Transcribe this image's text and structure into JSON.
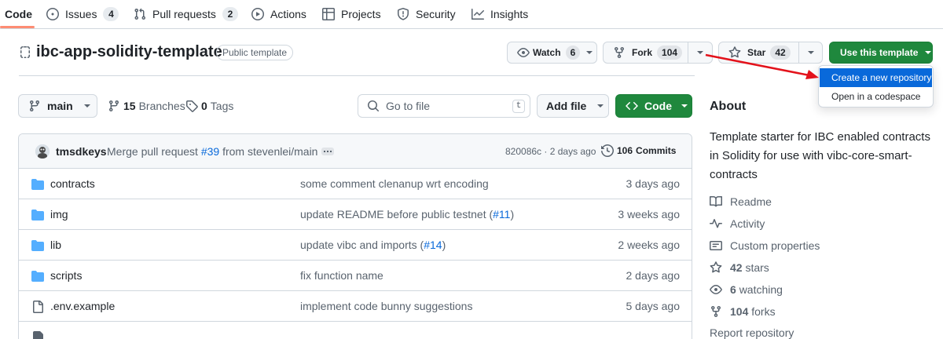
{
  "nav": {
    "tabs": [
      {
        "label": "Code",
        "icon": "code-icon"
      },
      {
        "label": "Issues",
        "count": "4",
        "icon": "issue-icon"
      },
      {
        "label": "Pull requests",
        "count": "2",
        "icon": "pull-request-icon"
      },
      {
        "label": "Actions",
        "icon": "play-icon"
      },
      {
        "label": "Projects",
        "icon": "table-icon"
      },
      {
        "label": "Security",
        "icon": "shield-icon"
      },
      {
        "label": "Insights",
        "icon": "graph-icon"
      }
    ]
  },
  "repo": {
    "name": "ibc-app-solidity-template",
    "visibility": "Public template",
    "watch_label": "Watch",
    "watch_count": "6",
    "fork_label": "Fork",
    "fork_count": "104",
    "star_label": "Star",
    "star_count": "42",
    "template_label": "Use this template"
  },
  "template_menu": {
    "items": [
      "Create a new repository",
      "Open in a codespace"
    ]
  },
  "toolbar": {
    "branch": "main",
    "branches_count": "15",
    "branches_label": "Branches",
    "tags_count": "0",
    "tags_label": "Tags",
    "search_placeholder": "Go to file",
    "search_key": "t",
    "add_file_label": "Add file",
    "code_label": "Code"
  },
  "commit": {
    "author": "tmsdkeys",
    "message_prefix": "Merge pull request",
    "pr_link": "#39",
    "message_suffix": "from stevenlei/main",
    "hash_time": "820086c · 2 days ago",
    "commits_count": "106",
    "commits_label": "Commits"
  },
  "files": [
    {
      "name": "contracts",
      "type": "folder",
      "msg": "some comment clenanup wrt encoding",
      "date": "3 days ago"
    },
    {
      "name": "img",
      "type": "folder",
      "msg": "update README before public testnet (",
      "link": "#11",
      "msg_end": ")",
      "date": "3 weeks ago"
    },
    {
      "name": "lib",
      "type": "folder",
      "msg": "update vibc and imports (",
      "link": "#14",
      "msg_end": ")",
      "date": "2 weeks ago"
    },
    {
      "name": "scripts",
      "type": "folder",
      "msg": "fix function name",
      "date": "2 days ago"
    },
    {
      "name": ".env.example",
      "type": "file",
      "msg": "implement code bunny suggestions",
      "date": "5 days ago"
    }
  ],
  "about": {
    "heading": "About",
    "description": "Template starter for IBC enabled contracts in Solidity for use with vibc-core-smart-contracts",
    "readme": "Readme",
    "activity": "Activity",
    "custom_properties": "Custom properties",
    "stars_count": "42",
    "stars_label": "stars",
    "watching_count": "6",
    "watching_label": "watching",
    "forks_count": "104",
    "forks_label": "forks",
    "report": "Report repository"
  },
  "colors": {
    "accent_link": "#0969da",
    "primary_green": "#1f883d",
    "folder": "#54aeff",
    "annotation_arrow": "#e3121b"
  }
}
